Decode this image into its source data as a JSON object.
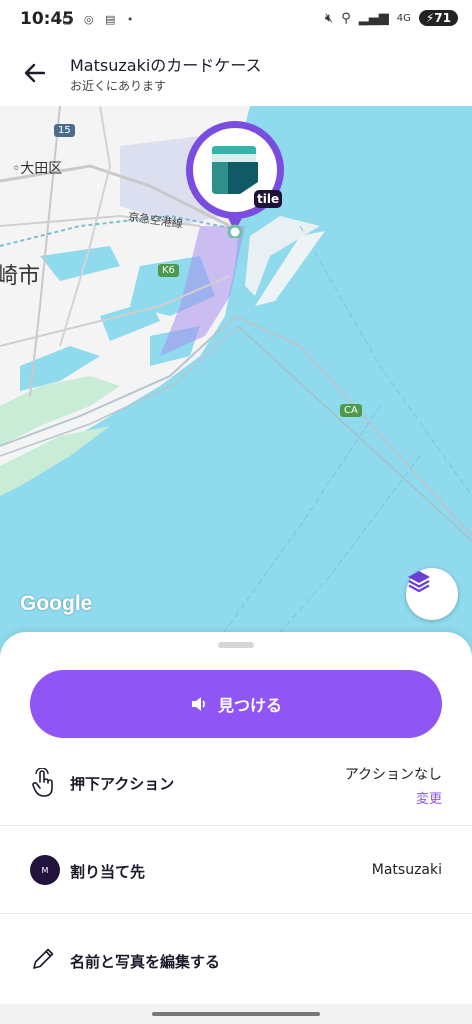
{
  "status_bar": {
    "time": "10:45",
    "left_icons": [
      "wifi-icon",
      "screenshot-icon",
      "calendar-icon",
      "dot"
    ],
    "network": "4G",
    "battery": "71"
  },
  "header": {
    "title": "Matsuzakiのカードケース",
    "subtitle": "お近くにあります"
  },
  "map": {
    "labels": {
      "ota_ward": "大田区",
      "kawasaki": "崎市",
      "keikyu_line": "京急空港線",
      "route_15": "15",
      "route_k6": "K6",
      "route_ca": "CA"
    },
    "watermark": "Google",
    "tile_badge": "tile",
    "colors": {
      "water": "#8fdaed",
      "land": "#f4f4f4",
      "green": "#c8ecd6",
      "pin": "#7a4ce0"
    }
  },
  "sheet": {
    "find_button": "見つける",
    "press_action": {
      "label": "押下アクション",
      "value": "アクションなし",
      "link": "変更"
    },
    "assigned_to": {
      "label": "割り当て先",
      "value": "Matsuzaki",
      "avatar_initial": "M"
    },
    "edit": {
      "label": "名前と写真を編集する"
    }
  },
  "accent_color": "#8f55f5"
}
